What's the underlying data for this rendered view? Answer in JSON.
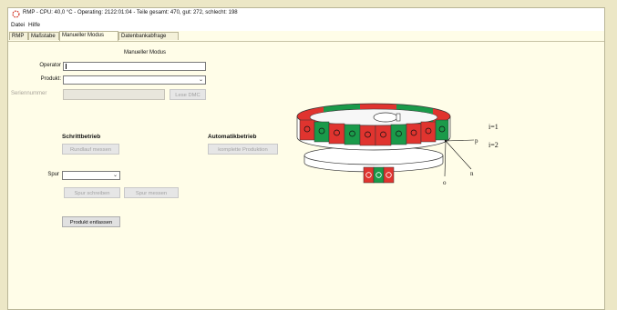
{
  "window": {
    "title": "RMP - CPU: 40,0 °C - Operating: 2122:01:04 - Teile gesamt: 470, gut: 272, schlecht: 198"
  },
  "menu": [
    "Datei",
    "Hilfe"
  ],
  "tabs": [
    "RMP",
    "Maßstabe",
    "Manueller Modus",
    "Datenbankabfrage"
  ],
  "panel": {
    "title": "Manueller Modus",
    "operator_label": "Operator",
    "operator_value": "",
    "produkt_label": "Produkt:",
    "produkt_value": "",
    "seriennummer_label": "Seriennummer",
    "seriennummer_value": "",
    "lese_dmc_label": "Lese DMC"
  },
  "schrittbetrieb": {
    "heading": "Schrittbetrieb",
    "rundlauf_label": "Rundlauf messen"
  },
  "automatikbetrieb": {
    "heading": "Automatikbetrieb",
    "komplette_label": "komplette Produktion"
  },
  "spur": {
    "label": "Spur",
    "value": "",
    "schreiben_label": "Spur schreiben",
    "messen_label": "Spur messen"
  },
  "produkt_entlassen_label": "Produkt entlassen",
  "diagram": {
    "label_i1": "i=1",
    "label_i2": "i=2",
    "label_p": "p",
    "label_n": "n",
    "label_o": "o",
    "colors": {
      "red": "#e0342f",
      "green": "#1a9a4a",
      "gray": "#d6d6d6"
    }
  }
}
